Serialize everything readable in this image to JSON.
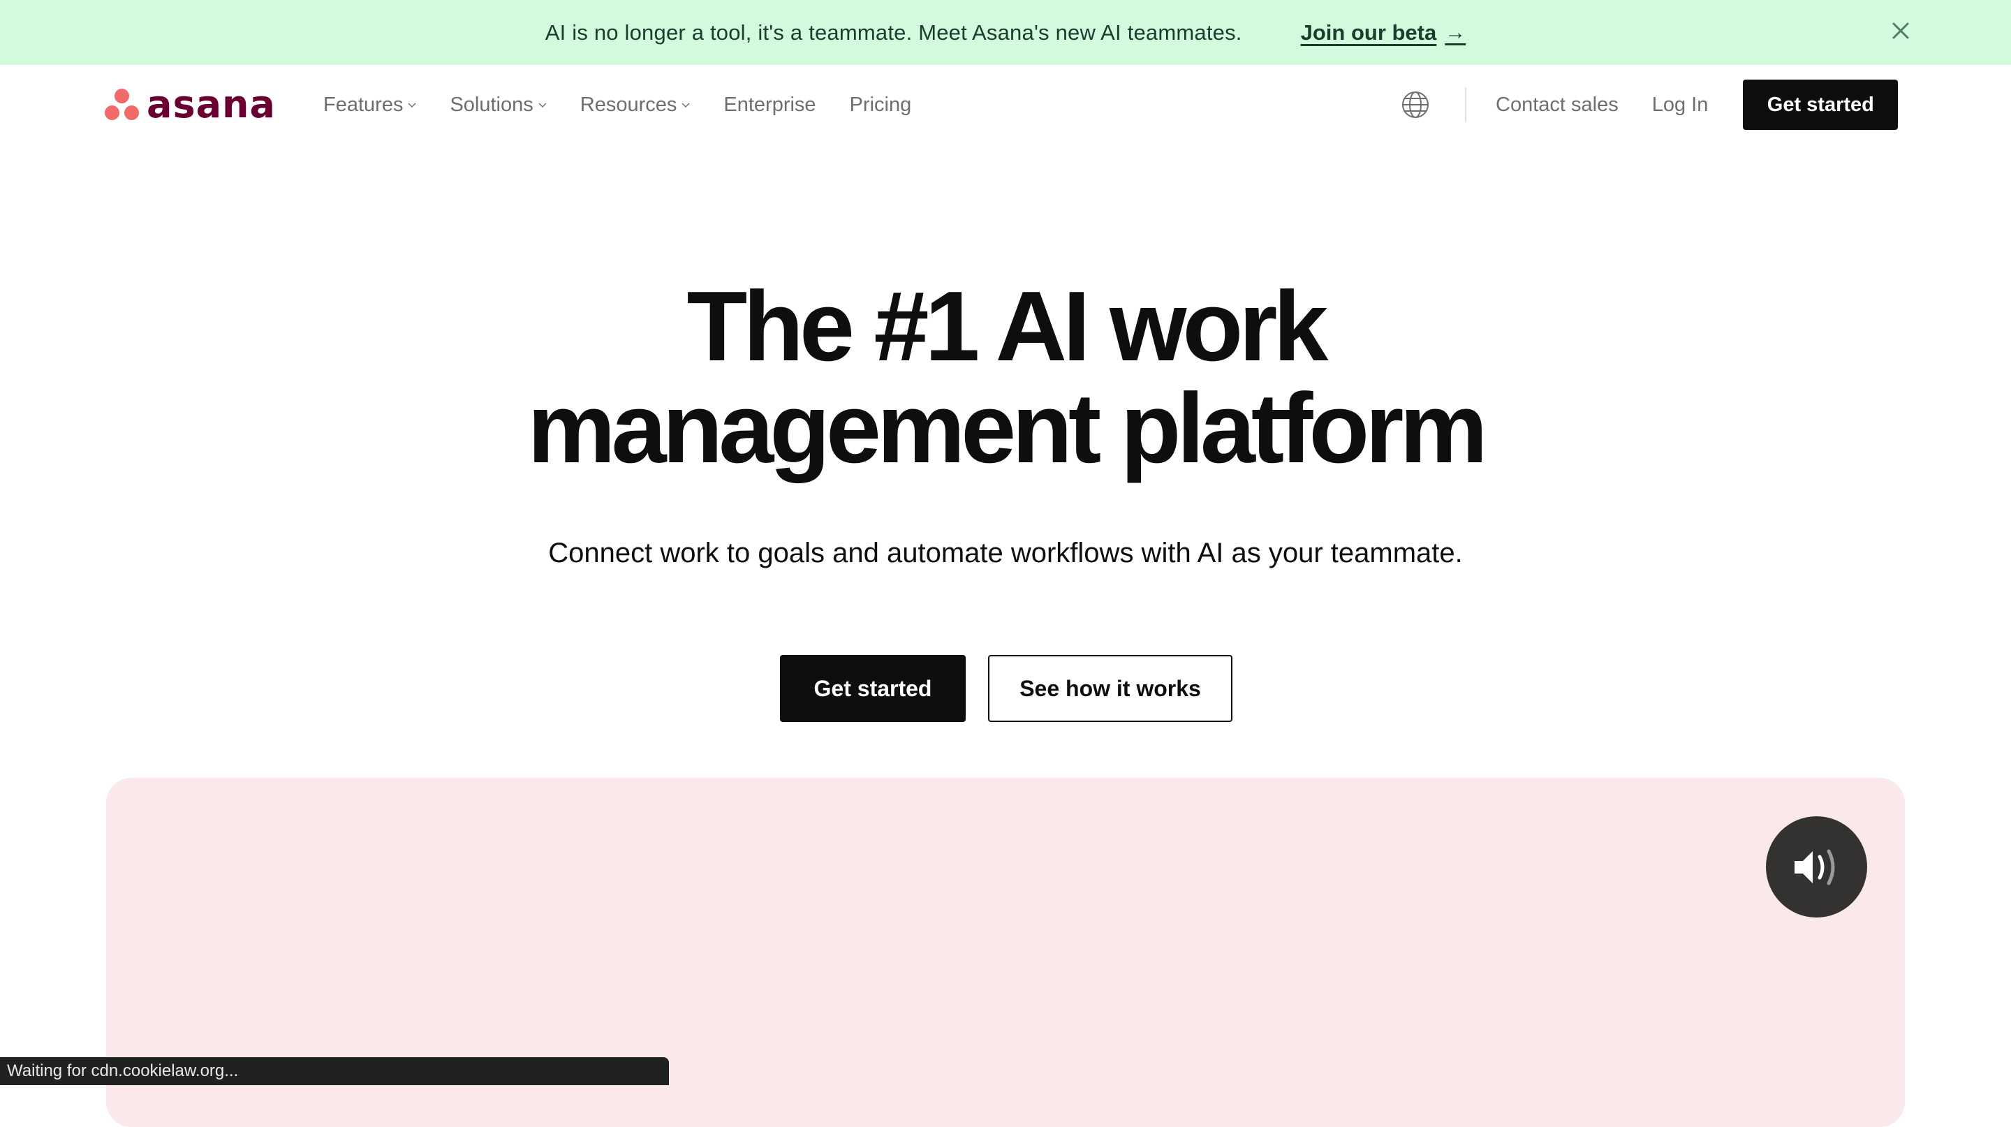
{
  "banner": {
    "message": "AI is no longer a tool, it's a teammate. Meet Asana's new AI teammates.",
    "link_label": "Join our beta",
    "link_icon": "arrow-right-icon",
    "close_icon": "close-icon",
    "bg_color": "#d3fadd"
  },
  "nav": {
    "logo_text": "asana",
    "items": [
      {
        "label": "Features",
        "has_dropdown": true
      },
      {
        "label": "Solutions",
        "has_dropdown": true
      },
      {
        "label": "Resources",
        "has_dropdown": true
      },
      {
        "label": "Enterprise",
        "has_dropdown": false
      },
      {
        "label": "Pricing",
        "has_dropdown": false
      }
    ],
    "language_icon": "globe-icon",
    "contact_sales": "Contact sales",
    "log_in": "Log In",
    "get_started": "Get started"
  },
  "hero": {
    "title_line1": "The #1 AI work",
    "title_line2": "management platform",
    "subtitle": "Connect work to goals and automate workflows with AI as your teammate.",
    "primary_cta": "Get started",
    "secondary_cta": "See how it works"
  },
  "media": {
    "card_color": "#fbe8ea",
    "sound_icon": "speaker-volume-icon"
  },
  "status_bar": {
    "text": "Waiting for cdn.cookielaw.org..."
  },
  "colors": {
    "brand_coral": "#f06a6a",
    "brand_plum": "#690031",
    "dark": "#0d0e10"
  }
}
